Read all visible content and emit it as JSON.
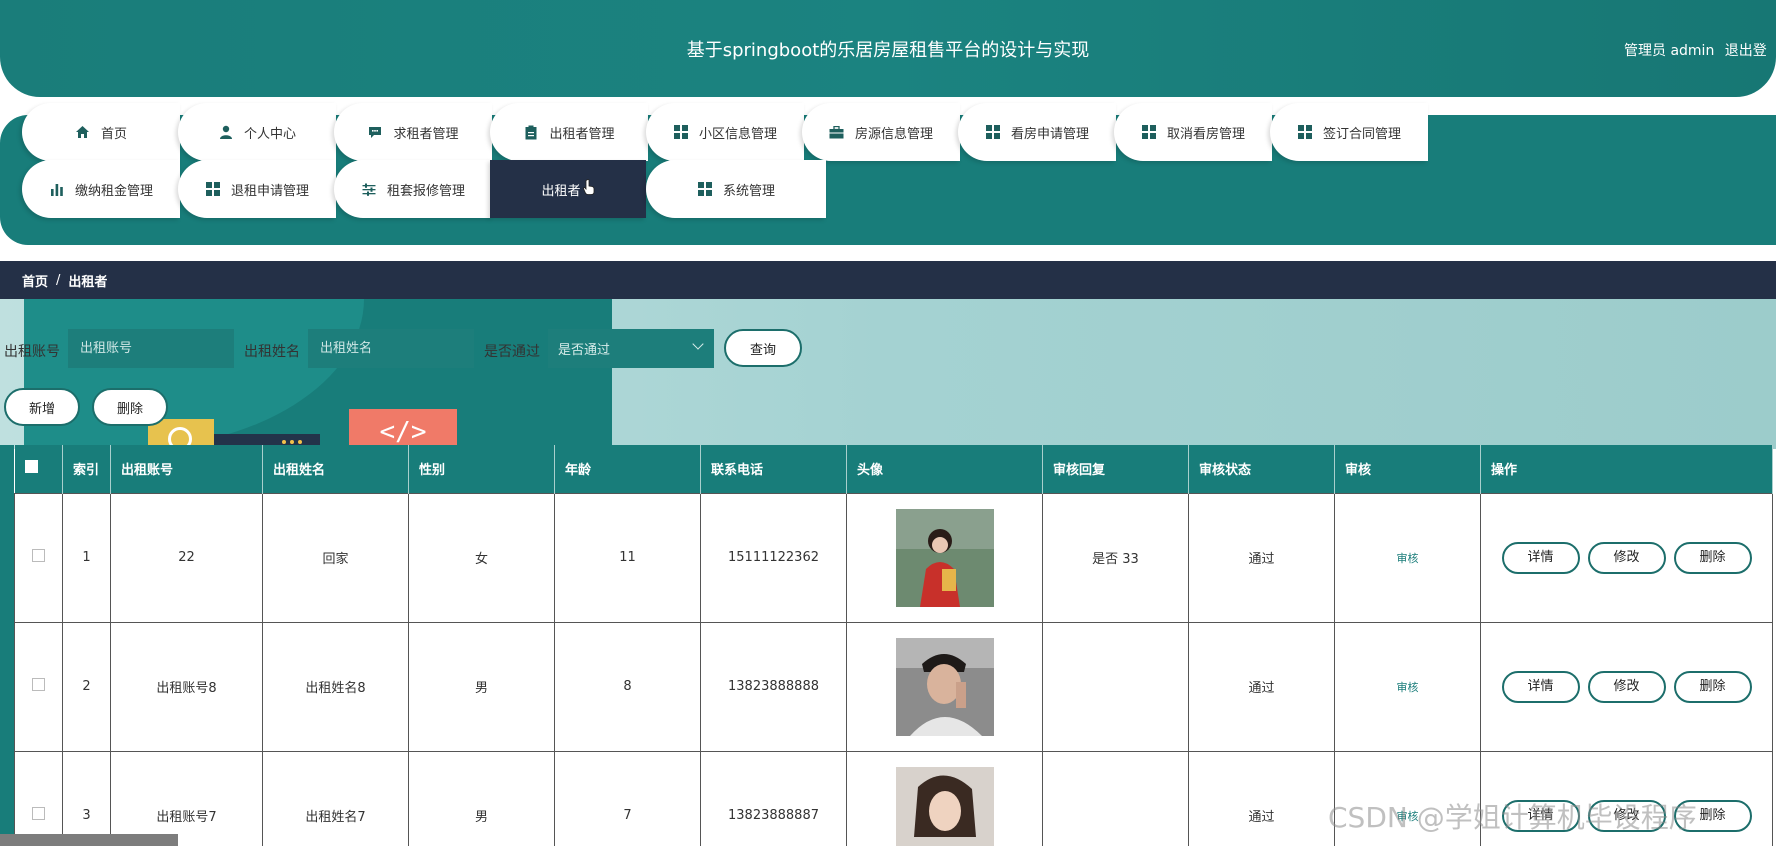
{
  "header": {
    "title": "基于springboot的乐居房屋租售平台的设计与实现",
    "user_label": "管理员 admin",
    "logout_label": "退出登"
  },
  "nav": {
    "row1": [
      {
        "label": "首页",
        "icon": "home-icon"
      },
      {
        "label": "个人中心",
        "icon": "user-icon"
      },
      {
        "label": "求租者管理",
        "icon": "chat-icon"
      },
      {
        "label": "出租者管理",
        "icon": "clipboard-icon"
      },
      {
        "label": "小区信息管理",
        "icon": "grid-icon"
      },
      {
        "label": "房源信息管理",
        "icon": "briefcase-icon"
      },
      {
        "label": "看房申请管理",
        "icon": "grid-icon"
      },
      {
        "label": "取消看房管理",
        "icon": "grid-icon"
      },
      {
        "label": "签订合同管理",
        "icon": "grid-icon"
      }
    ],
    "row2": [
      {
        "label": "缴纳租金管理",
        "icon": "bar-chart-icon"
      },
      {
        "label": "退租申请管理",
        "icon": "grid-icon"
      },
      {
        "label": "租套报修管理",
        "icon": "sliders-icon"
      },
      {
        "label": "出租者",
        "icon": "",
        "active": true
      },
      {
        "label": "系统管理",
        "icon": "grid-icon"
      }
    ]
  },
  "breadcrumb": {
    "home": "首页",
    "separator": "/",
    "current": "出租者"
  },
  "search": {
    "account_label": "出租账号",
    "account_placeholder": "出租账号",
    "name_label": "出租姓名",
    "name_placeholder": "出租姓名",
    "pass_label": "是否通过",
    "pass_value": "是否通过",
    "query_button": "查询"
  },
  "actions": {
    "add_button": "新增",
    "delete_button": "删除"
  },
  "table": {
    "headers": [
      "索引",
      "出租账号",
      "出租姓名",
      "性别",
      "年龄",
      "联系电话",
      "头像",
      "审核回复",
      "审核状态",
      "审核",
      "操作"
    ],
    "rows": [
      {
        "index": "1",
        "account": "22",
        "name": "回家",
        "gender": "女",
        "age": "11",
        "phone": "15111122362",
        "reply": "是否 33",
        "status": "通过",
        "audit": "审核"
      },
      {
        "index": "2",
        "account": "出租账号8",
        "name": "出租姓名8",
        "gender": "男",
        "age": "8",
        "phone": "13823888888",
        "reply": "",
        "status": "通过",
        "audit": "审核"
      },
      {
        "index": "3",
        "account": "出租账号7",
        "name": "出租姓名7",
        "gender": "男",
        "age": "7",
        "phone": "13823888887",
        "reply": "",
        "status": "通过",
        "audit": "审核"
      }
    ],
    "op_labels": {
      "detail": "详情",
      "edit": "修改",
      "delete": "删除"
    }
  },
  "colors": {
    "primary": "#187d7a",
    "dark": "#243047",
    "accent_bg": "#a4d2d2"
  },
  "watermark": "CSDN @学姐计算机毕设程序"
}
